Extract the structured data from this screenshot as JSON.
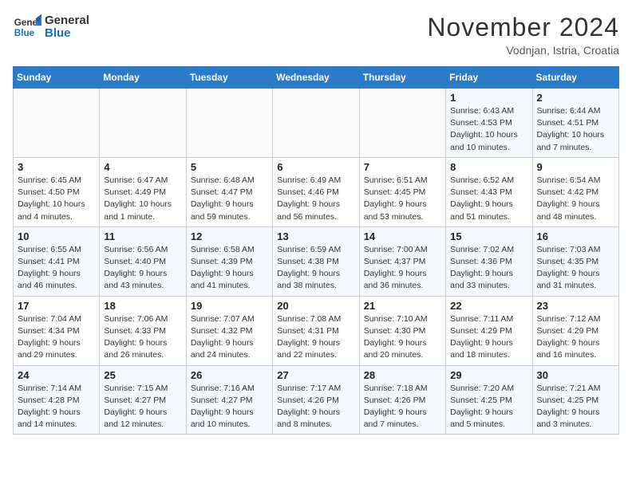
{
  "header": {
    "logo_line1": "General",
    "logo_line2": "Blue",
    "month": "November 2024",
    "location": "Vodnjan, Istria, Croatia"
  },
  "weekdays": [
    "Sunday",
    "Monday",
    "Tuesday",
    "Wednesday",
    "Thursday",
    "Friday",
    "Saturday"
  ],
  "weeks": [
    [
      {
        "day": "",
        "info": ""
      },
      {
        "day": "",
        "info": ""
      },
      {
        "day": "",
        "info": ""
      },
      {
        "day": "",
        "info": ""
      },
      {
        "day": "",
        "info": ""
      },
      {
        "day": "1",
        "info": "Sunrise: 6:43 AM\nSunset: 4:53 PM\nDaylight: 10 hours and 10 minutes."
      },
      {
        "day": "2",
        "info": "Sunrise: 6:44 AM\nSunset: 4:51 PM\nDaylight: 10 hours and 7 minutes."
      }
    ],
    [
      {
        "day": "3",
        "info": "Sunrise: 6:45 AM\nSunset: 4:50 PM\nDaylight: 10 hours and 4 minutes."
      },
      {
        "day": "4",
        "info": "Sunrise: 6:47 AM\nSunset: 4:49 PM\nDaylight: 10 hours and 1 minute."
      },
      {
        "day": "5",
        "info": "Sunrise: 6:48 AM\nSunset: 4:47 PM\nDaylight: 9 hours and 59 minutes."
      },
      {
        "day": "6",
        "info": "Sunrise: 6:49 AM\nSunset: 4:46 PM\nDaylight: 9 hours and 56 minutes."
      },
      {
        "day": "7",
        "info": "Sunrise: 6:51 AM\nSunset: 4:45 PM\nDaylight: 9 hours and 53 minutes."
      },
      {
        "day": "8",
        "info": "Sunrise: 6:52 AM\nSunset: 4:43 PM\nDaylight: 9 hours and 51 minutes."
      },
      {
        "day": "9",
        "info": "Sunrise: 6:54 AM\nSunset: 4:42 PM\nDaylight: 9 hours and 48 minutes."
      }
    ],
    [
      {
        "day": "10",
        "info": "Sunrise: 6:55 AM\nSunset: 4:41 PM\nDaylight: 9 hours and 46 minutes."
      },
      {
        "day": "11",
        "info": "Sunrise: 6:56 AM\nSunset: 4:40 PM\nDaylight: 9 hours and 43 minutes."
      },
      {
        "day": "12",
        "info": "Sunrise: 6:58 AM\nSunset: 4:39 PM\nDaylight: 9 hours and 41 minutes."
      },
      {
        "day": "13",
        "info": "Sunrise: 6:59 AM\nSunset: 4:38 PM\nDaylight: 9 hours and 38 minutes."
      },
      {
        "day": "14",
        "info": "Sunrise: 7:00 AM\nSunset: 4:37 PM\nDaylight: 9 hours and 36 minutes."
      },
      {
        "day": "15",
        "info": "Sunrise: 7:02 AM\nSunset: 4:36 PM\nDaylight: 9 hours and 33 minutes."
      },
      {
        "day": "16",
        "info": "Sunrise: 7:03 AM\nSunset: 4:35 PM\nDaylight: 9 hours and 31 minutes."
      }
    ],
    [
      {
        "day": "17",
        "info": "Sunrise: 7:04 AM\nSunset: 4:34 PM\nDaylight: 9 hours and 29 minutes."
      },
      {
        "day": "18",
        "info": "Sunrise: 7:06 AM\nSunset: 4:33 PM\nDaylight: 9 hours and 26 minutes."
      },
      {
        "day": "19",
        "info": "Sunrise: 7:07 AM\nSunset: 4:32 PM\nDaylight: 9 hours and 24 minutes."
      },
      {
        "day": "20",
        "info": "Sunrise: 7:08 AM\nSunset: 4:31 PM\nDaylight: 9 hours and 22 minutes."
      },
      {
        "day": "21",
        "info": "Sunrise: 7:10 AM\nSunset: 4:30 PM\nDaylight: 9 hours and 20 minutes."
      },
      {
        "day": "22",
        "info": "Sunrise: 7:11 AM\nSunset: 4:29 PM\nDaylight: 9 hours and 18 minutes."
      },
      {
        "day": "23",
        "info": "Sunrise: 7:12 AM\nSunset: 4:29 PM\nDaylight: 9 hours and 16 minutes."
      }
    ],
    [
      {
        "day": "24",
        "info": "Sunrise: 7:14 AM\nSunset: 4:28 PM\nDaylight: 9 hours and 14 minutes."
      },
      {
        "day": "25",
        "info": "Sunrise: 7:15 AM\nSunset: 4:27 PM\nDaylight: 9 hours and 12 minutes."
      },
      {
        "day": "26",
        "info": "Sunrise: 7:16 AM\nSunset: 4:27 PM\nDaylight: 9 hours and 10 minutes."
      },
      {
        "day": "27",
        "info": "Sunrise: 7:17 AM\nSunset: 4:26 PM\nDaylight: 9 hours and 8 minutes."
      },
      {
        "day": "28",
        "info": "Sunrise: 7:18 AM\nSunset: 4:26 PM\nDaylight: 9 hours and 7 minutes."
      },
      {
        "day": "29",
        "info": "Sunrise: 7:20 AM\nSunset: 4:25 PM\nDaylight: 9 hours and 5 minutes."
      },
      {
        "day": "30",
        "info": "Sunrise: 7:21 AM\nSunset: 4:25 PM\nDaylight: 9 hours and 3 minutes."
      }
    ]
  ]
}
